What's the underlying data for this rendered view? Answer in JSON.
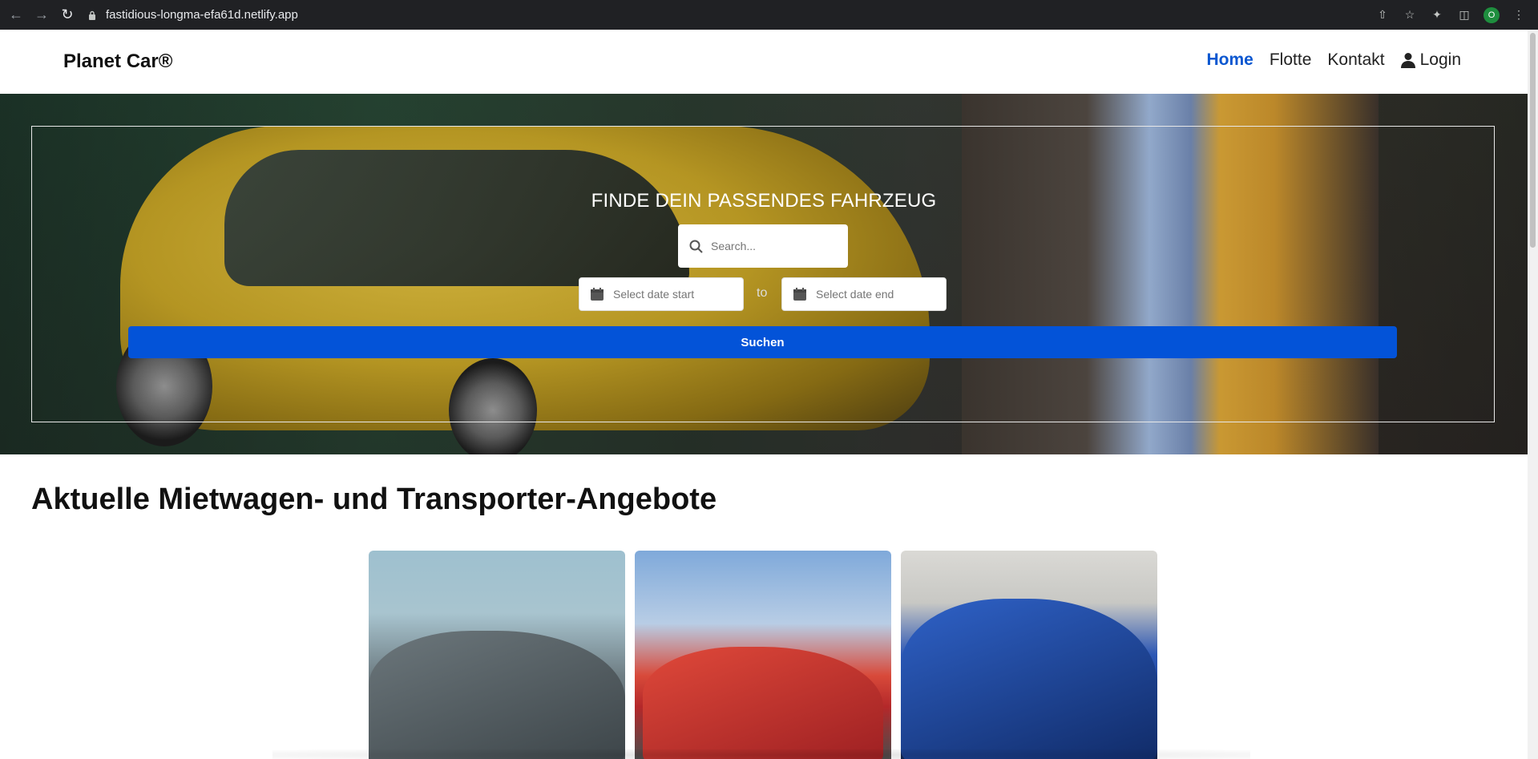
{
  "browser": {
    "url": "fastidious-longma-efa61d.netlify.app",
    "profile_initial": "O",
    "icons": [
      "back-icon",
      "forward-icon",
      "reload-icon",
      "lock-icon",
      "share-icon",
      "star-icon",
      "extensions-icon",
      "sidebar-icon",
      "menu-icon"
    ]
  },
  "header": {
    "brand": "Planet Car®",
    "nav": [
      {
        "label": "Home",
        "active": true
      },
      {
        "label": "Flotte",
        "active": false
      },
      {
        "label": "Kontakt",
        "active": false
      },
      {
        "label": "Login",
        "active": false,
        "icon": "user-icon"
      }
    ]
  },
  "hero": {
    "title": "FINDE DEIN PASSENDES FAHRZEUG",
    "search_placeholder": "Search...",
    "date_start_placeholder": "Select date start",
    "date_separator": "to",
    "date_end_placeholder": "Select date end",
    "submit_label": "Suchen"
  },
  "offers": {
    "title": "Aktuelle Mietwagen- und Transporter-Angebote"
  },
  "colors": {
    "accent": "#0353d8",
    "nav_active": "#0b57d0"
  }
}
